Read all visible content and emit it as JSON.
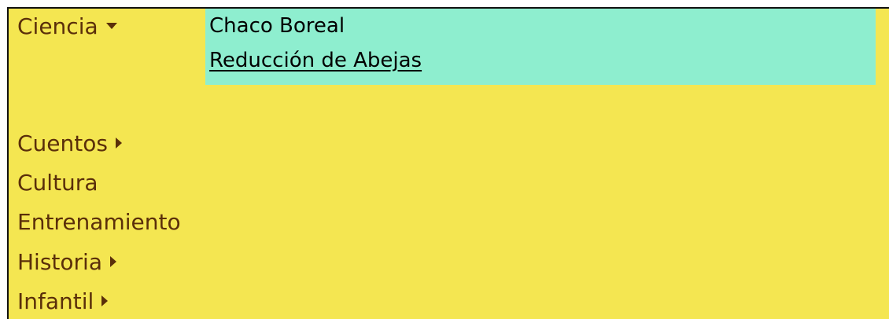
{
  "menu": {
    "items": [
      {
        "label": "Ciencia",
        "arrow": "down-triangle-icon",
        "expanded": true
      },
      {
        "label": "Cuentos",
        "arrow": "right-triangle-icon"
      },
      {
        "label": "Cultura"
      },
      {
        "label": "Entrenamiento"
      },
      {
        "label": "Historia",
        "arrow": "right-triangle-icon"
      },
      {
        "label": "Infantil",
        "arrow": "right-triangle-icon"
      }
    ]
  },
  "submenu": {
    "items": [
      {
        "label": "Chaco Boreal"
      },
      {
        "label": "Reducción de Abejas"
      }
    ]
  },
  "colors": {
    "menu_background": "#f4e651",
    "submenu_background": "#8eeecf",
    "menu_text": "#5a2f0a",
    "submenu_text": "#000000"
  }
}
